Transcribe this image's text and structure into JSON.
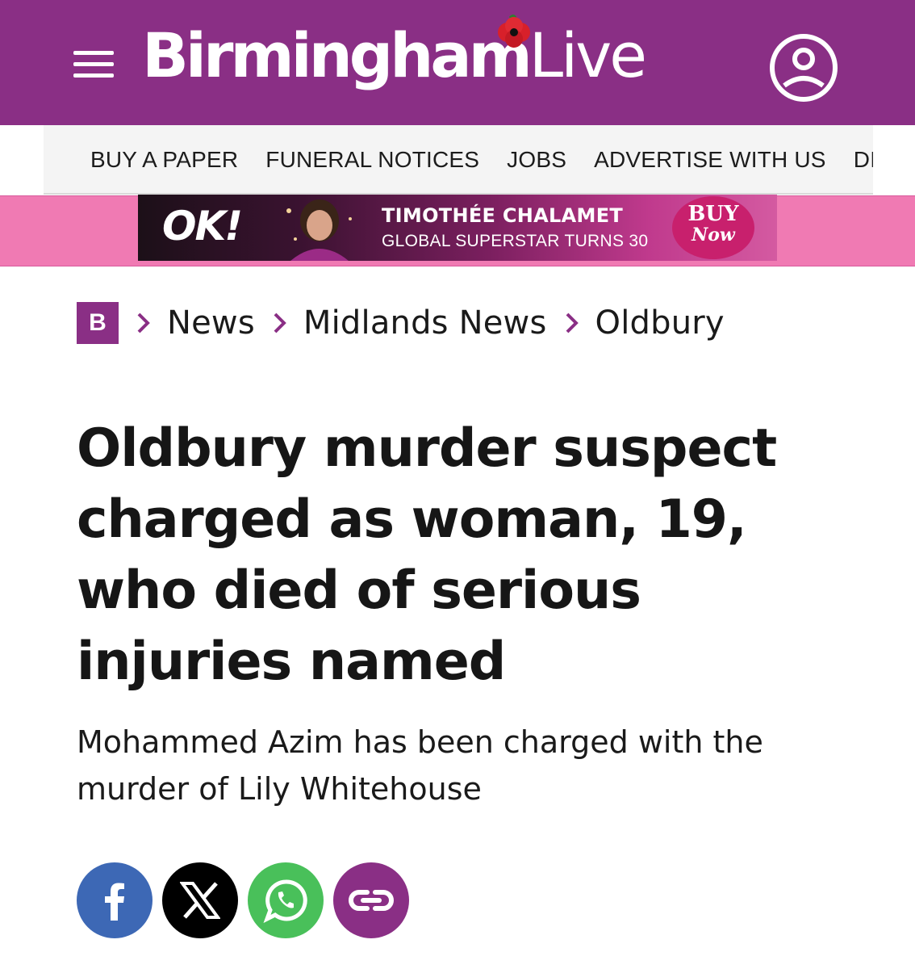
{
  "header": {
    "brand_main": "Birmingham",
    "brand_live": "Live",
    "colors": {
      "brand_purple": "#8a2f85",
      "poppy_red": "#d8202a"
    }
  },
  "nav": {
    "items": [
      "BUY A PAPER",
      "FUNERAL NOTICES",
      "JOBS",
      "ADVERTISE WITH US",
      "DIRE"
    ]
  },
  "ad": {
    "logo": "OK!",
    "title": "TIMOTHÉE CHALAMET",
    "subtitle": "GLOBAL SUPERSTAR TURNS 30",
    "cta_line1": "BUY",
    "cta_line2": "Now"
  },
  "breadcrumb": {
    "home": "B",
    "items": [
      "News",
      "Midlands News",
      "Oldbury"
    ]
  },
  "article": {
    "headline": "Oldbury murder suspect charged as woman, 19, who died of serious injuries named",
    "standfirst": "Mohammed Azim has been charged with the murder of Lily Whitehouse"
  },
  "share": {
    "icons": [
      "facebook-icon",
      "x-icon",
      "whatsapp-icon",
      "link-icon"
    ],
    "colors": {
      "facebook": "#3d68b5",
      "x": "#000000",
      "whatsapp": "#49c05a",
      "link": "#8a2f85"
    }
  }
}
